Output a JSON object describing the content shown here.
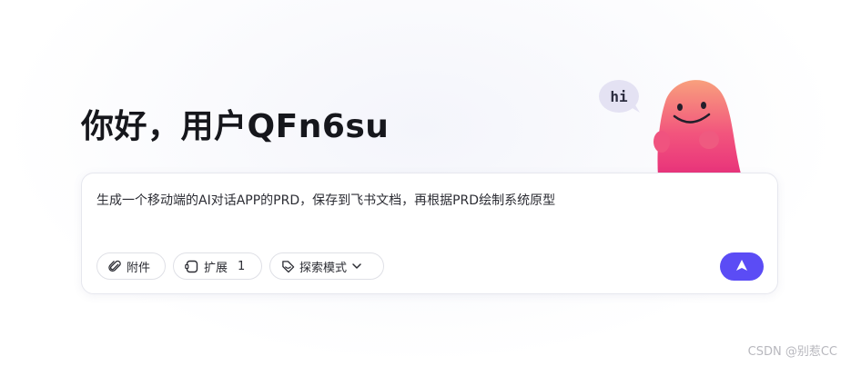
{
  "greeting": "你好，用户QFn6su",
  "mascot": {
    "bubble_text": "hi"
  },
  "prompt": {
    "value": "生成一个移动端的AI对话APP的PRD，保存到飞书文档，再根据PRD绘制系统原型"
  },
  "toolbar": {
    "attach_label": "附件",
    "extension_label": "扩展",
    "extension_count": "1",
    "mode_label": "探索模式"
  },
  "icons": {
    "attach": "paperclip-icon",
    "extension": "extension-icon",
    "mode": "tag-icon",
    "dropdown": "chevron-down-icon",
    "send": "send-arrow-icon"
  },
  "colors": {
    "accent": "#5b4cf5",
    "mascot": "#f2557d"
  },
  "watermark": "CSDN @别惹CC"
}
